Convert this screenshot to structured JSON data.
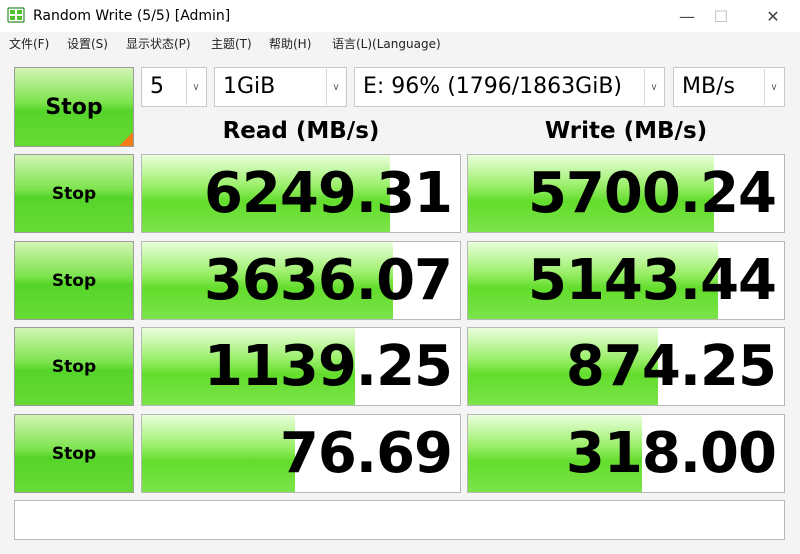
{
  "window": {
    "title": "Random Write (5/5) [Admin]",
    "minimize_glyph": "—",
    "maximize_glyph": "☐",
    "close_glyph": "✕"
  },
  "menu": [
    "文件(F)",
    "设置(S)",
    "显示状态(P)",
    "主题(T)",
    "帮助(H)",
    "语言(L)(Language)"
  ],
  "controls": {
    "main_button": "Stop",
    "count": "5",
    "size": "1GiB",
    "drive": "E: 96% (1796/1863GiB)",
    "unit": "MB/s"
  },
  "headers": {
    "read": "Read (MB/s)",
    "write": "Write (MB/s)"
  },
  "rows": [
    {
      "button": "Stop",
      "read": "6249.31",
      "write": "5700.24",
      "read_fill": 0.78,
      "write_fill": 0.78
    },
    {
      "button": "Stop",
      "read": "3636.07",
      "write": "5143.44",
      "read_fill": 0.79,
      "write_fill": 0.79
    },
    {
      "button": "Stop",
      "read": "1139.25",
      "write": "874.25",
      "read_fill": 0.67,
      "write_fill": 0.6
    },
    {
      "button": "Stop",
      "read": "76.69",
      "write": "318.00",
      "read_fill": 0.48,
      "write_fill": 0.55
    }
  ],
  "status": "",
  "colors": {
    "bar_green": "#63dd2c",
    "corner_orange": "#f07b17"
  }
}
